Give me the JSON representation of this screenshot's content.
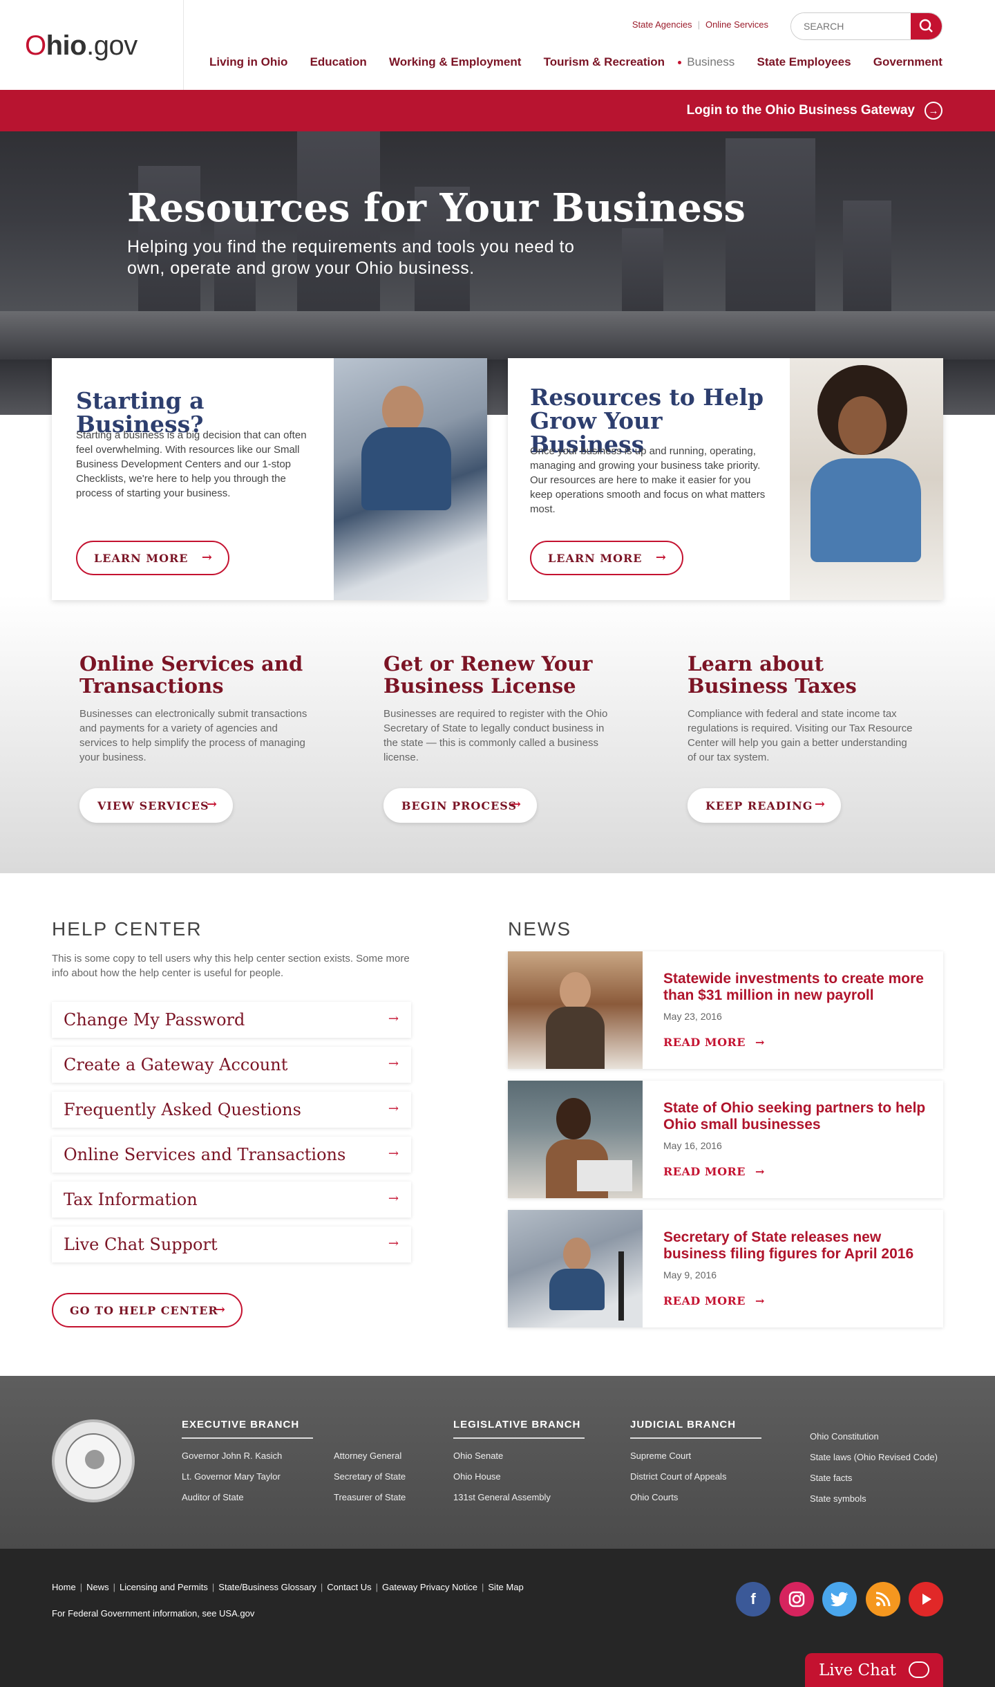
{
  "header": {
    "logo_o": "O",
    "logo_text": "hio",
    "logo_suffix": ".gov",
    "utility": [
      "State Agencies",
      "Online Services"
    ],
    "search_placeholder": "SEARCH",
    "nav": [
      "Living in Ohio",
      "Education",
      "Working & Employment",
      "Tourism & Recreation",
      "Business",
      "State Employees",
      "Government"
    ],
    "active_nav": "Business"
  },
  "hero": {
    "gateway_link": "Login to the Ohio Business Gateway",
    "title": "Resources for Your Business",
    "subtitle": "Helping you find the requirements and tools you need to own, operate and grow your Ohio business."
  },
  "cards": [
    {
      "title": "Starting a Business?",
      "body": "Starting a business is a big decision that can often feel overwhelming. With resources like our Small Business Development Centers and our 1-stop Checklists, we're here to help you through the process of starting your business.",
      "button": "LEARN MORE"
    },
    {
      "title": "Resources to Help Grow Your Business",
      "body": "Once your business is up and running, operating, managing and growing your business take priority. Our resources are here to make it easier for you keep operations smooth and focus on what matters most.",
      "button": "LEARN MORE"
    }
  ],
  "columns": [
    {
      "title": "Online Services and Transactions",
      "body": "Businesses can electronically submit transactions and payments for a variety of agencies and services to help simplify the process of managing your business.",
      "button": "VIEW SERVICES"
    },
    {
      "title": "Get or Renew Your Business License",
      "body": "Businesses are required to register with the Ohio Secretary of State to legally conduct business in the state — this is commonly called a business license.",
      "button": "BEGIN PROCESS"
    },
    {
      "title": "Learn about Business Taxes",
      "body": "Compliance with federal and state income tax regulations is required. Visiting our Tax Resource Center will help you gain a better understanding of our tax system.",
      "button": "KEEP READING"
    }
  ],
  "help_center": {
    "heading": "HELP CENTER",
    "description": "This is some copy to tell users why this help center section exists. Some more info about how the help center is useful for people.",
    "items": [
      "Change My Password",
      "Create a Gateway Account",
      "Frequently Asked Questions",
      "Online Services and Transactions",
      "Tax Information",
      "Live Chat Support"
    ],
    "button": "GO TO HELP CENTER"
  },
  "news": {
    "heading": "NEWS",
    "read_more": "READ MORE",
    "items": [
      {
        "title": "Statewide investments to create more than $31 million in new payroll",
        "date": "May 23, 2016"
      },
      {
        "title": "State of Ohio seeking partners to help Ohio small businesses",
        "date": "May 16, 2016"
      },
      {
        "title": "Secretary of State releases new business filing figures for April 2016",
        "date": "May 9, 2016"
      }
    ]
  },
  "footer": {
    "executive": {
      "heading": "EXECUTIVE BRANCH",
      "links": [
        "Governor John R. Kasich",
        "Lt. Governor Mary Taylor",
        "Auditor of State",
        "Attorney General",
        "Secretary of State",
        "Treasurer of State"
      ]
    },
    "legislative": {
      "heading": "LEGISLATIVE BRANCH",
      "links": [
        "Ohio Senate",
        "Ohio House",
        "131st General Assembly"
      ]
    },
    "judicial": {
      "heading": "JUDICIAL BRANCH",
      "links": [
        "Supreme Court",
        "District Court of Appeals",
        "Ohio Courts"
      ]
    },
    "misc_links": [
      "Ohio Constitution",
      "State laws (Ohio Revised Code)",
      "State facts",
      "State symbols"
    ],
    "bottom_links": [
      "Home",
      "News",
      "Licensing and Permits",
      "State/Business Glossary",
      "Contact Us",
      "Gateway Privacy Notice",
      "Site Map"
    ],
    "federal": "For Federal Government information, see USA.gov",
    "social": [
      "facebook-icon",
      "instagram-icon",
      "twitter-icon",
      "rss-icon",
      "youtube-icon"
    ],
    "social_colors": [
      "#3b5998",
      "#d6245e",
      "#4aa6ec",
      "#f5971f",
      "#e12828"
    ],
    "live_chat": "Live Chat"
  }
}
